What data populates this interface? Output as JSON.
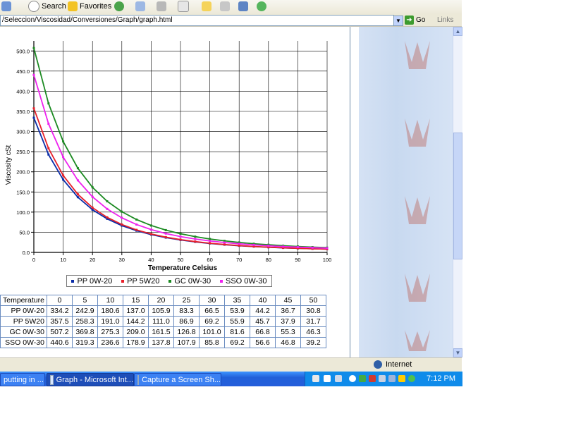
{
  "toolbar": {
    "search_label": "Search",
    "favorites_label": "Favorites"
  },
  "address": {
    "url": "/Seleccion/Viscosidad/Conversiones/Graph/graph.html",
    "go_label": "Go",
    "links_label": "Links"
  },
  "chart_data": {
    "type": "line",
    "title": "",
    "xlabel": "Temperature Celsius",
    "ylabel": "Viscosity cSt",
    "xlim": [
      0,
      100
    ],
    "ylim": [
      0,
      525
    ],
    "x_ticks": [
      "0",
      "10",
      "20",
      "30",
      "40",
      "50",
      "60",
      "70",
      "80",
      "90",
      "100"
    ],
    "y_ticks": [
      "0.0",
      "50.0",
      "100.0",
      "150.0",
      "200.0",
      "250.0",
      "300.0",
      "350.0",
      "400.0",
      "450.0",
      "500.0"
    ],
    "grid": true,
    "legend_position": "bottom",
    "x": [
      0,
      5,
      10,
      15,
      20,
      25,
      30,
      35,
      40,
      45,
      50,
      55,
      60,
      65,
      70,
      75,
      80,
      85,
      90,
      95,
      100
    ],
    "series": [
      {
        "name": "PP 0W-20",
        "color": "#0a2ca8",
        "marker": "square",
        "values": [
          334.2,
          242.9,
          180.6,
          137.0,
          105.9,
          83.3,
          66.5,
          53.9,
          44.2,
          36.7,
          30.8,
          26.1,
          22.2,
          19.1,
          16.5,
          14.4,
          12.7,
          11.2,
          10.0,
          9.0,
          8.1
        ]
      },
      {
        "name": "PP 5W20",
        "color": "#e8202a",
        "marker": "square",
        "values": [
          357.5,
          258.3,
          191.0,
          144.2,
          111.0,
          86.9,
          69.2,
          55.9,
          45.7,
          37.9,
          31.7,
          26.8,
          22.8,
          19.6,
          16.9,
          14.7,
          12.9,
          11.4,
          10.2,
          9.1,
          8.2
        ]
      },
      {
        "name": "GC 0W-30",
        "color": "#1c8a22",
        "marker": "square",
        "values": [
          507.2,
          369.8,
          275.3,
          209.0,
          161.5,
          126.8,
          101.0,
          81.6,
          66.8,
          55.3,
          46.3,
          39.1,
          33.3,
          28.6,
          24.7,
          21.5,
          18.9,
          16.6,
          14.7,
          13.1,
          11.7
        ]
      },
      {
        "name": "SSO 0W-30",
        "color": "#ee22ee",
        "marker": "square",
        "values": [
          440.6,
          319.3,
          236.6,
          178.9,
          137.8,
          107.9,
          85.8,
          69.2,
          56.6,
          46.8,
          39.2,
          33.2,
          28.4,
          24.5,
          21.3,
          18.6,
          16.4,
          14.5,
          13.0,
          11.7,
          10.5
        ]
      }
    ]
  },
  "table": {
    "header_label": "Temperature",
    "columns": [
      "0",
      "5",
      "10",
      "15",
      "20",
      "25",
      "30",
      "35",
      "40",
      "45",
      "50"
    ],
    "rows": [
      {
        "label": "PP 0W-20",
        "values": [
          "334.2",
          "242.9",
          "180.6",
          "137.0",
          "105.9",
          "83.3",
          "66.5",
          "53.9",
          "44.2",
          "36.7",
          "30.8"
        ]
      },
      {
        "label": "PP 5W20",
        "values": [
          "357.5",
          "258.3",
          "191.0",
          "144.2",
          "111.0",
          "86.9",
          "69.2",
          "55.9",
          "45.7",
          "37.9",
          "31.7"
        ]
      },
      {
        "label": "GC 0W-30",
        "values": [
          "507.2",
          "369.8",
          "275.3",
          "209.0",
          "161.5",
          "126.8",
          "101.0",
          "81.6",
          "66.8",
          "55.3",
          "46.3"
        ]
      },
      {
        "label": "SSO 0W-30",
        "values": [
          "440.6",
          "319.3",
          "236.6",
          "178.9",
          "137.8",
          "107.9",
          "85.8",
          "69.2",
          "56.6",
          "46.8",
          "39.2"
        ]
      }
    ]
  },
  "status": {
    "zone_label": "Internet"
  },
  "taskbar": {
    "tasks": [
      {
        "label": "putting in ..."
      },
      {
        "label": "Graph - Microsoft Int..."
      },
      {
        "label": "Capture a Screen Sh..."
      }
    ],
    "clock": "7:12 PM"
  }
}
